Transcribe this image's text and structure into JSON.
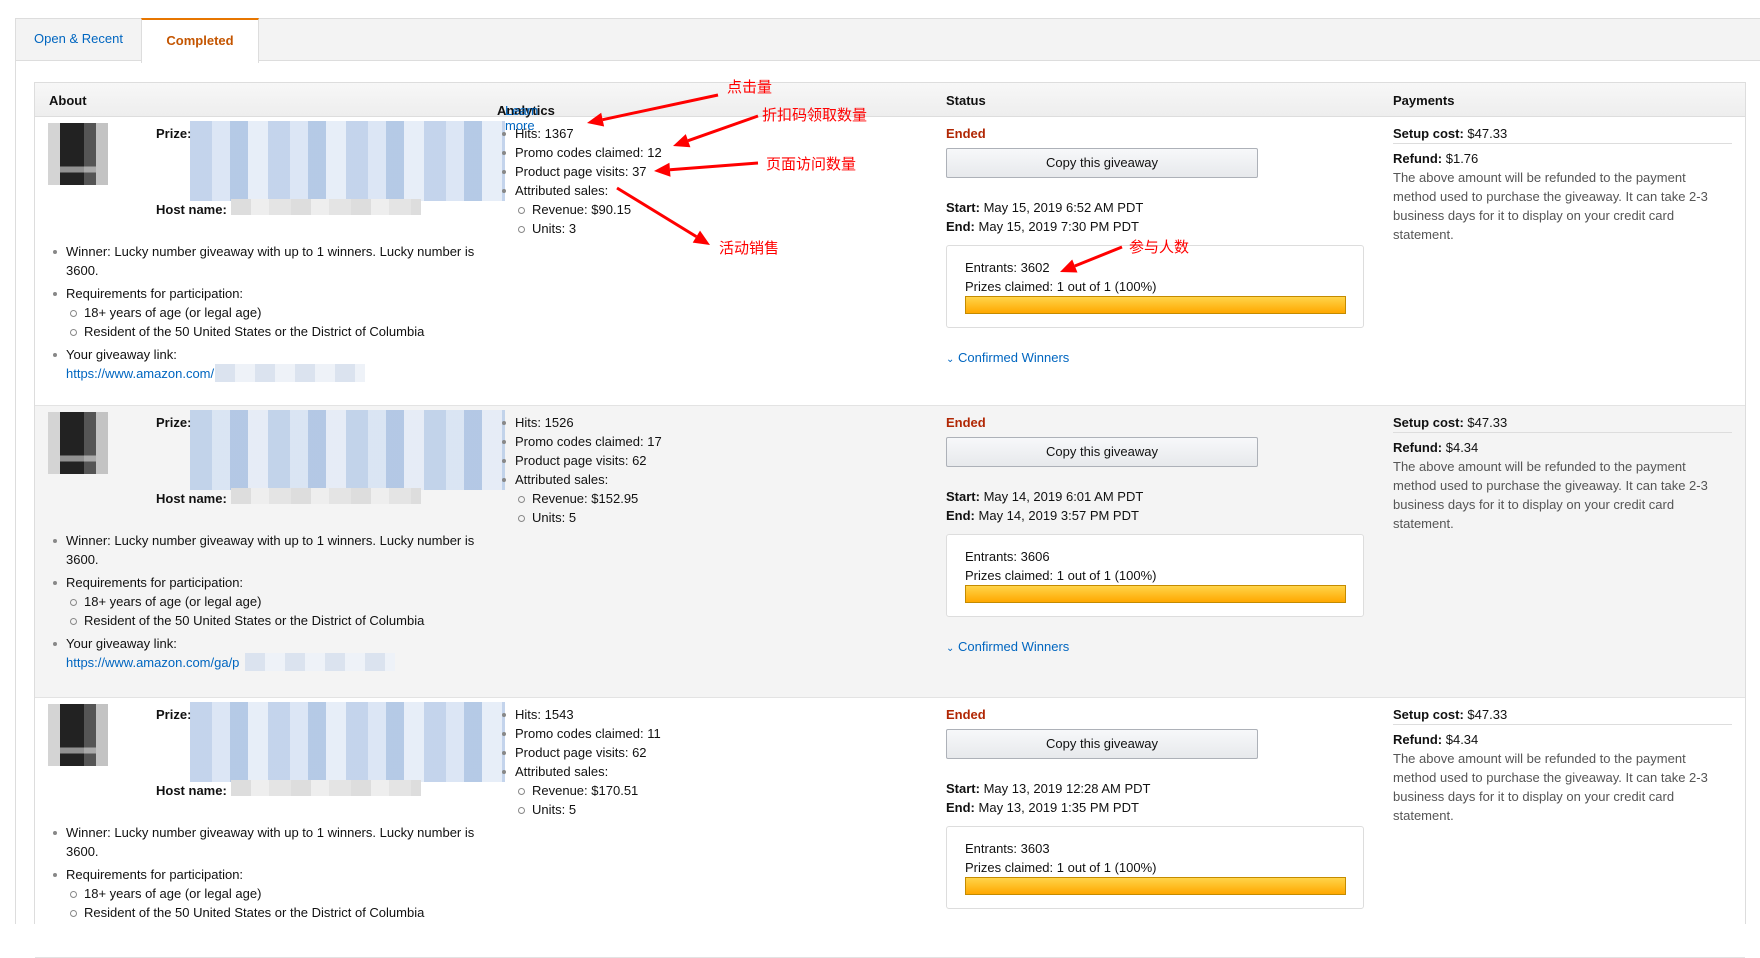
{
  "tabs": [
    {
      "label": "Open & Recent",
      "active": false
    },
    {
      "label": "Completed",
      "active": true
    }
  ],
  "header": {
    "about": "About",
    "analytics": "Analytics",
    "learn_more": "Learn more",
    "status": "Status",
    "payments": "Payments"
  },
  "labels": {
    "prize": "Prize:",
    "host": "Host name:",
    "winner": "Winner:",
    "winner_text": "Lucky number giveaway with up to 1 winners. Lucky number is",
    "lucky": "3600.",
    "req": "Requirements for participation:",
    "req1": "18+ years of age (or legal age)",
    "req2": "Resident of the 50 United States or the District of Columbia",
    "link_label": "Your giveaway link:",
    "hits": "Hits:",
    "promo": "Promo codes claimed:",
    "visits": "Product page visits:",
    "sales": "Attributed sales:",
    "revenue": "Revenue:",
    "units": "Units:",
    "copy": "Copy this giveaway",
    "start": "Start:",
    "end": "End:",
    "entrants": "Entrants:",
    "prizes": "Prizes claimed:",
    "confirmed": "Confirmed Winners",
    "setup": "Setup cost:",
    "refund": "Refund:",
    "refund_note": [
      "The above amount will be refunded to the payment",
      "method used to purchase the giveaway. It can take 2-3",
      "business days for it to display on your credit card",
      "statement."
    ]
  },
  "giveaways": [
    {
      "link": "https://www.amazon.com/",
      "hits": "1367",
      "promo": "12",
      "visits": "37",
      "revenue": "$90.15",
      "units": "3",
      "status": "Ended",
      "start": "May 15, 2019 6:52 AM PDT",
      "end": "May 15, 2019 7:30 PM PDT",
      "entrants": "3602",
      "prizes": "1 out of 1 (100%)",
      "claimed_pct": 100,
      "setup": "$47.33",
      "refund": "$1.76"
    },
    {
      "link": "https://www.amazon.com/ga/p",
      "hits": "1526",
      "promo": "17",
      "visits": "62",
      "revenue": "$152.95",
      "units": "5",
      "status": "Ended",
      "start": "May 14, 2019 6:01 AM PDT",
      "end": "May 14, 2019 3:57 PM PDT",
      "entrants": "3606",
      "prizes": "1 out of 1 (100%)",
      "claimed_pct": 100,
      "setup": "$47.33",
      "refund": "$4.34"
    },
    {
      "hits": "1543",
      "promo": "11",
      "visits": "62",
      "revenue": "$170.51",
      "units": "5",
      "status": "Ended",
      "start": "May 13, 2019 12:28 AM PDT",
      "end": "May 13, 2019 1:35 PM PDT",
      "entrants": "3603",
      "prizes": "1 out of 1 (100%)",
      "claimed_pct": 100,
      "setup": "$47.33",
      "refund": "$4.34"
    }
  ],
  "annotations": {
    "hits": "点击量",
    "promo": "折扣码领取数量",
    "visits": "页面访问数量",
    "sales": "活动销售",
    "entrants": "参与人数",
    "color": "#ff0000"
  }
}
